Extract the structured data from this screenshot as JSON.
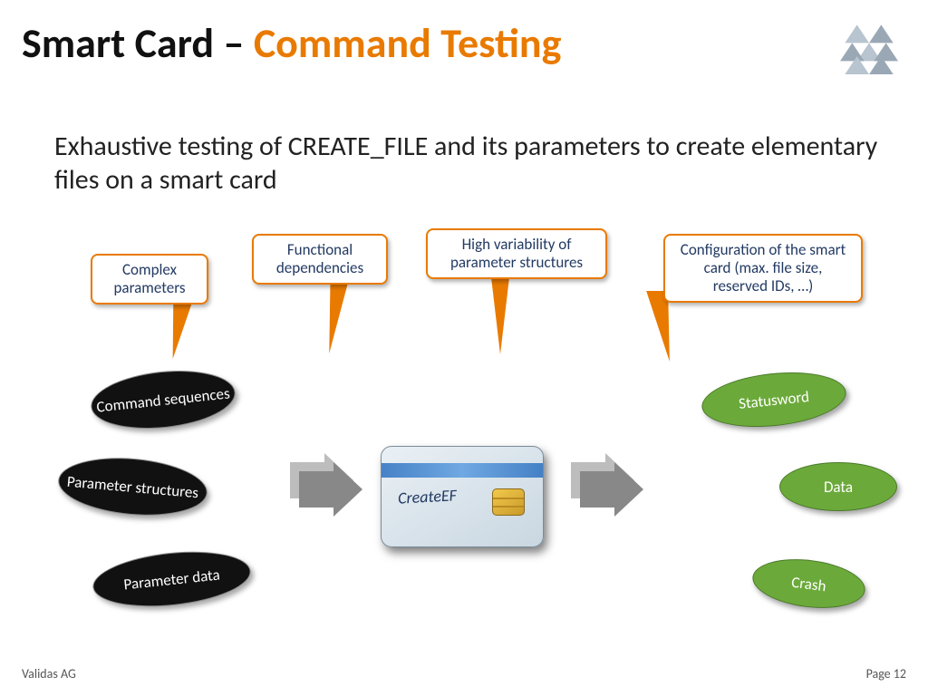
{
  "title": {
    "part1": "Smart Card – ",
    "part2": "Command Testing"
  },
  "subtitle": "Exhaustive testing of CREATE_FILE and its parameters to create elementary files on a smart card",
  "callouts": {
    "complex_params": "Complex parameters",
    "functional_deps": "Functional dependencies",
    "high_variability": "High variability of parameter structures",
    "configuration": "Configuration of the smart card (max. file size, reserved IDs, …)"
  },
  "inputs": {
    "command_sequences": "Command sequences",
    "parameter_structures": "Parameter structures",
    "parameter_data": "Parameter data"
  },
  "center": {
    "label": "CreateEF"
  },
  "outputs": {
    "statusword": "Statusword",
    "data": "Data",
    "crash": "Crash"
  },
  "footer": {
    "company": "Validas AG",
    "page": "Page 12"
  }
}
